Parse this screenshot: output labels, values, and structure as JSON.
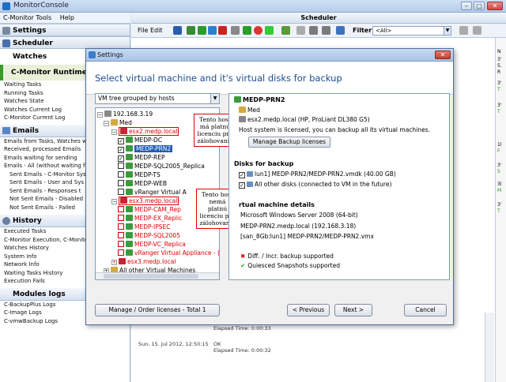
{
  "app": {
    "title": "MonitorConsole"
  },
  "menubar": {
    "items": [
      "C-Monitor Tools",
      "Help"
    ]
  },
  "scheduler": {
    "title": "Scheduler"
  },
  "toolbar": {
    "file": "File",
    "edit": "Edit",
    "filter_label": "Filter",
    "filter_value": "<All>"
  },
  "left_panel": {
    "settings": "Settings",
    "scheduler": "Scheduler",
    "watches": "Watches",
    "cmonitor_runtime": "C-Monitor Runtime In",
    "runtime_items": [
      "Waiting Tasks",
      "Running Tasks",
      "Watches State",
      "Watches Current Log",
      "C-Monitor Current Log"
    ],
    "emails": "Emails",
    "email_items": [
      "Emails from Tasks, Watches w",
      "Received, processed Emails",
      "Emails waiting for sending",
      "Emails - All (without waiting fo"
    ],
    "email_subitems": [
      "Sent Emails - C-Monitor Sys",
      "Sent Emails - User and Sys",
      "Sent Emails - Responses t",
      "Not Sent Emails - Disabled",
      "Not Sent Emails - Failed"
    ],
    "history": "History",
    "history_items": [
      "Executed Tasks",
      "C-Monitor Execution, C-Monito",
      "Watches History",
      "System Info",
      "Network Info",
      "Waiting Tasks History",
      "Execution Fails"
    ],
    "modules_logs": "Modules logs",
    "module_items": [
      "C-BackupPlus Logs",
      "C-Image Logs",
      "C-vmwBackup Logs"
    ]
  },
  "log_entries": [
    {
      "date": "",
      "status": "",
      "elapsed": "Elapsed Time: 0:00:33"
    },
    {
      "date": "Sun, 15. Jul 2012, 12:50:15",
      "status": "OK",
      "elapsed": "Elapsed Time: 0:00:32"
    }
  ],
  "right_col": {
    "header": "N",
    "values": [
      "3'",
      "5.",
      "R",
      "3'",
      "T",
      "3'",
      "T",
      "1l",
      "F",
      "3'",
      "S",
      "3l",
      "M",
      "3'",
      "T"
    ]
  },
  "dialog": {
    "title": "Settings",
    "banner": "Select virtual machine and it's virtual disks for backup",
    "combo_value": "VM tree grouped by hosts",
    "tree": {
      "root": "192.168.3.19",
      "datacenter": "Med",
      "host1": "esx2.medp.local",
      "host1_vms": [
        "MEDP-DC",
        "MEDP-PRN2",
        "MEDP-REP",
        "MEDP-SQL2005_Replica",
        "MEDP-TS",
        "MEDP-WEB",
        "vRanger Virtual A"
      ],
      "host2": "esx3.medp.local",
      "host2_vms": [
        "MEDP-CAM_Rep",
        "MEDP-EX_Replic",
        "MEDP-IPSEC",
        "MEDP-SQL2005",
        "MEDP-VC_Replica",
        "vRanger Virtual Appliance - ("
      ],
      "host3": "esx3.medp.local",
      "all_other": "All other Virtual Machines"
    },
    "callout1": [
      "Tento host",
      "má platnú",
      "licenciu pre",
      "zálohovanie"
    ],
    "callout2": [
      "Tento host",
      "nemá platnú",
      "licenciu pre",
      "zálohovanie"
    ],
    "details": {
      "vm_name": "MEDP-PRN2",
      "datacenter": "Med",
      "host": "esx2.medp.local (HP, ProLiant DL380 G5)",
      "license_msg": "Host system is licensed, you can backup all its virtual machines.",
      "manage_button": "Manage Backup licenses",
      "disks_header": "Disks for backup",
      "disk1": "lun1] MEDP-PRN2/MEDP-PRN2.vmdk (40.00 GB)",
      "disk_other": "All other disks (connected to VM in the future)",
      "vm_details_header": "rtual machine details",
      "os": "Microsoft Windows Server 2008 (64-bit)",
      "hostname": "MEDP-PRN2.medp.local (192.168.3.18)",
      "vmx": "[san_8Gb:lun1] MEDP-PRN2/MEDP-PRN2.vmx",
      "diff_backup": "Diff. / Incr. backup supported",
      "quiesced": "Quiesced Snapshots supported"
    },
    "buttons": {
      "manage_order": "Manage / Order licenses - Total 1",
      "previous": "< Previous",
      "next": "Next >",
      "cancel": "Cancel"
    }
  }
}
